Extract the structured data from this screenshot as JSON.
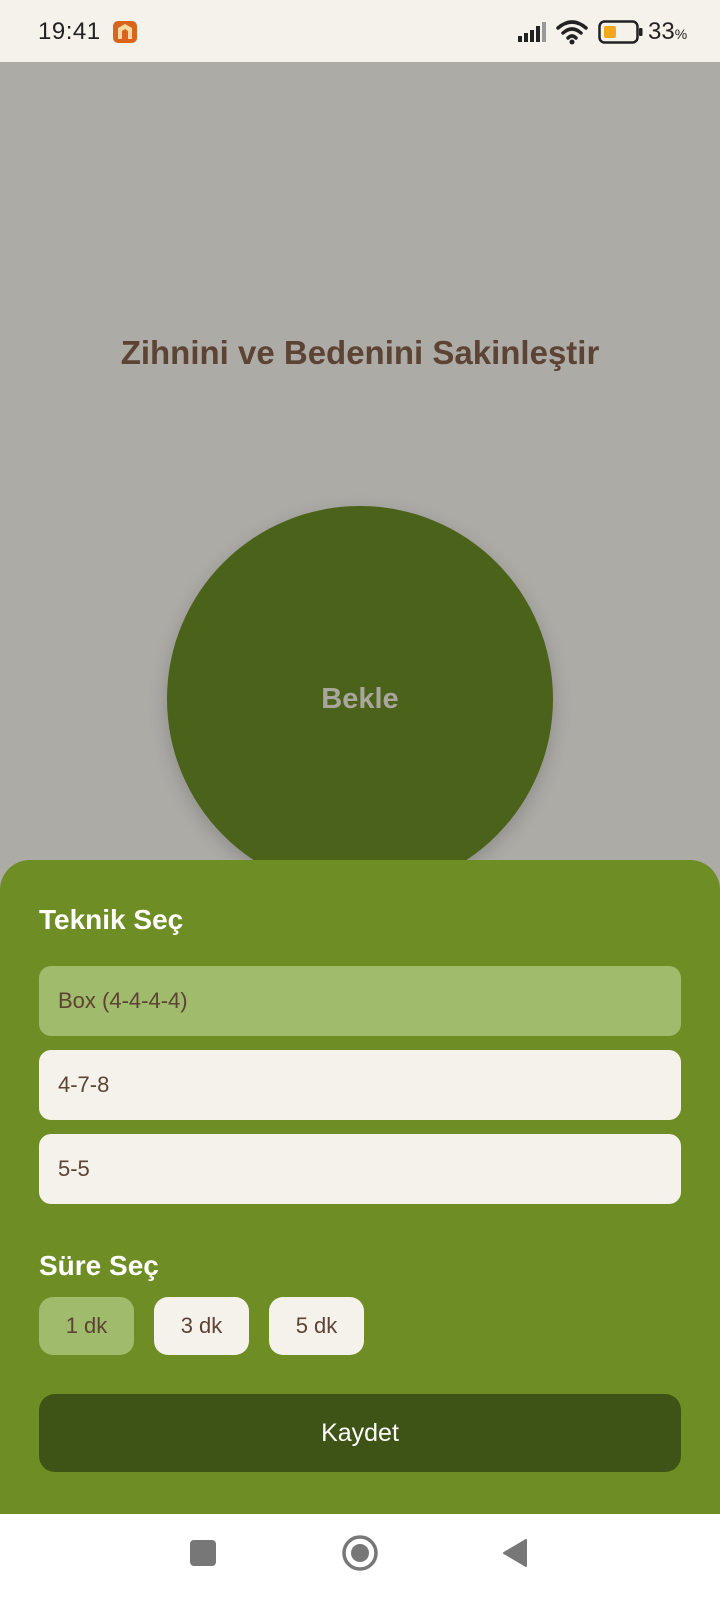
{
  "status_bar": {
    "time": "19:41",
    "battery_percent": "33",
    "battery_unit": "%",
    "icons": [
      "app-icon",
      "signal-icon",
      "wifi-icon",
      "battery-icon"
    ]
  },
  "main": {
    "title": "Zihnini ve Bedenini Sakinleştir",
    "circle_label": "Bekle"
  },
  "settings": {
    "technique_title": "Teknik Seç",
    "techniques": [
      {
        "label": "Box (4-4-4-4)",
        "selected": true
      },
      {
        "label": "4-7-8",
        "selected": false
      },
      {
        "label": "5-5",
        "selected": false
      }
    ],
    "duration_title": "Süre Seç",
    "durations": [
      {
        "label": "1 dk",
        "selected": true
      },
      {
        "label": "3 dk",
        "selected": false
      },
      {
        "label": "5 dk",
        "selected": false
      }
    ],
    "save_label": "Kaydet"
  },
  "nav_bar": {
    "icons": [
      "recents-icon",
      "home-icon",
      "back-icon"
    ]
  },
  "colors": {
    "background": "#acaba6",
    "circle": "#4a6219",
    "sheet": "#6e8e25",
    "selected": "#a0bb6c",
    "option": "#f4f2ea",
    "save_button": "#3e5416",
    "title_text": "#5d4334"
  }
}
